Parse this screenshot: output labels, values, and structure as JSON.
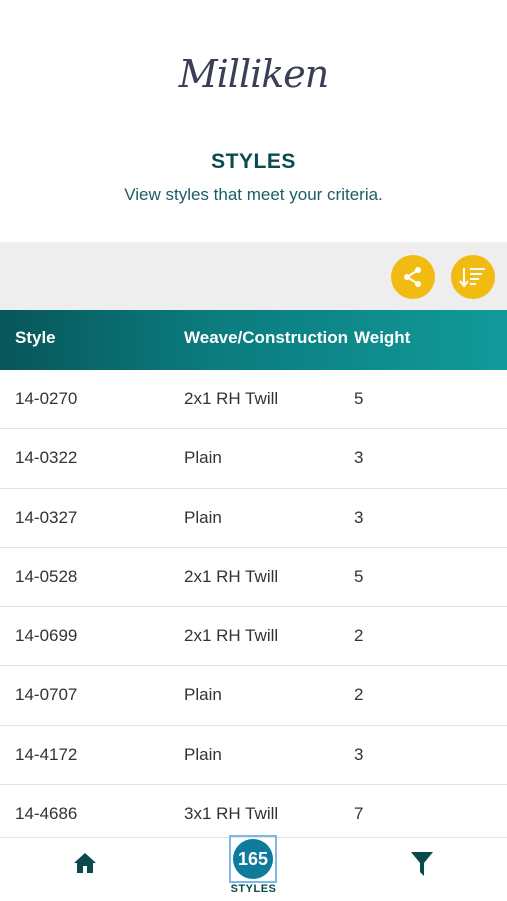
{
  "brand": {
    "logo_text": "Milliken"
  },
  "header": {
    "title": "STYLES",
    "subtitle": "View styles that meet your criteria."
  },
  "toolbar": {
    "share_icon": "share-icon",
    "sort_icon": "sort-icon",
    "accent_color": "#f2bb12"
  },
  "table": {
    "columns": [
      "Style",
      "Weave/Construction",
      "Weight"
    ],
    "rows": [
      {
        "style": "14-0270",
        "weave": "2x1 RH Twill",
        "weight": "5"
      },
      {
        "style": "14-0322",
        "weave": "Plain",
        "weight": "3"
      },
      {
        "style": "14-0327",
        "weave": "Plain",
        "weight": "3"
      },
      {
        "style": "14-0528",
        "weave": "2x1 RH Twill",
        "weight": "5"
      },
      {
        "style": "14-0699",
        "weave": "2x1 RH Twill",
        "weight": "2"
      },
      {
        "style": "14-0707",
        "weave": "Plain",
        "weight": "2"
      },
      {
        "style": "14-4172",
        "weave": "Plain",
        "weight": "3"
      },
      {
        "style": "14-4686",
        "weave": "3x1 RH Twill",
        "weight": "7"
      }
    ]
  },
  "bottom_nav": {
    "home_icon": "home-icon",
    "count": "165",
    "count_label": "STYLES",
    "filter_icon": "filter-icon"
  }
}
